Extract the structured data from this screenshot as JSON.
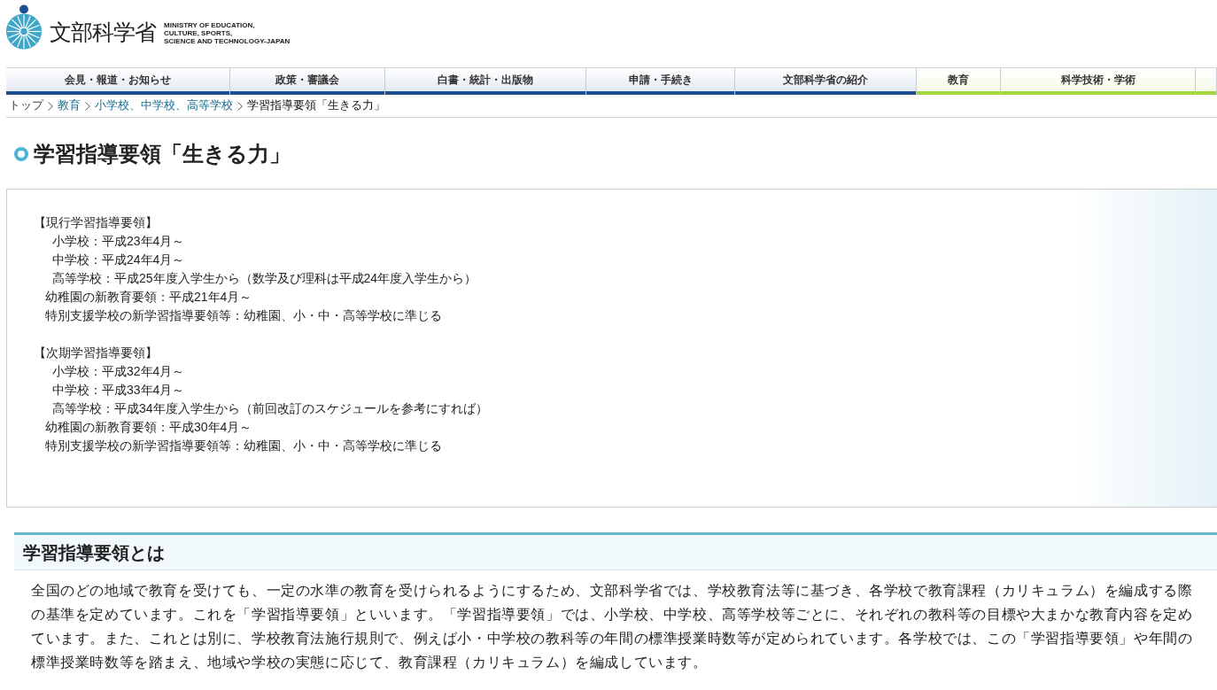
{
  "logo": {
    "name": "文部科学省",
    "tagline": [
      "MINISTRY OF EDUCATION,",
      "CULTURE, SPORTS,",
      "SCIENCE AND TECHNOLOGY-JAPAN"
    ]
  },
  "nav": [
    {
      "label": "会見・報道・お知らせ",
      "color": "#1c4f8f"
    },
    {
      "label": "政策・審議会",
      "color": "#1c4f8f"
    },
    {
      "label": "白書・統計・出版物",
      "color": "#1c4f8f"
    },
    {
      "label": "申請・手続き",
      "color": "#1c4f8f"
    },
    {
      "label": "文部科学省の紹介",
      "color": "#1c4f8f"
    },
    {
      "label": "教育",
      "color": "#a5d63f"
    },
    {
      "label": "科学技術・学術",
      "color": "#a5d63f"
    },
    {
      "color": "#a5d63f"
    }
  ],
  "breadcrumb": [
    {
      "label": "トップ",
      "kind": "top"
    },
    {
      "label": "教育",
      "kind": "link"
    },
    {
      "label": "小学校、中学校、高等学校",
      "kind": "link"
    },
    {
      "label": "学習指導要領「生きる力」",
      "kind": "current"
    }
  ],
  "title": "学習指導要領「生きる力」",
  "schedule": [
    {
      "heading": "【現行学習指導要領】",
      "items": [
        {
          "kind": "school",
          "text": "小学校：平成23年4月～"
        },
        {
          "kind": "school",
          "text": "中学校：平成24年4月～"
        },
        {
          "kind": "school",
          "text": "高等学校：平成25年度入学生から（数学及び理科は平成24年度入学生から）"
        },
        {
          "kind": "other",
          "text": "幼稚園の新教育要領：平成21年4月～"
        },
        {
          "kind": "other",
          "text": "特別支援学校の新学習指導要領等：幼稚園、小・中・高等学校に準じる"
        }
      ]
    },
    {
      "heading": "【次期学習指導要領】",
      "items": [
        {
          "kind": "school",
          "text": "小学校：平成32年4月～"
        },
        {
          "kind": "school",
          "text": "中学校：平成33年4月～"
        },
        {
          "kind": "school",
          "text": "高等学校：平成34年度入学生から（前回改訂のスケジュールを参考にすれば）"
        },
        {
          "kind": "other",
          "text": "幼稚園の新教育要領：平成30年4月～"
        },
        {
          "kind": "other",
          "text": "特別支援学校の新学習指導要領等：幼稚園、小・中・高等学校に準じる"
        }
      ]
    }
  ],
  "section": {
    "heading": "学習指導要領とは",
    "paragraph": "全国のどの地域で教育を受けても、一定の水準の教育を受けられるようにするため、文部科学省では、学校教育法等に基づき、各学校で教育課程（カリキュラム）を編成する際の基準を定めています。これを「学習指導要領」といいます。「学習指導要領」では、小学校、中学校、高等学校等ごとに、それぞれの教科等の目標や大まかな教育内容を定めています。また、これとは別に、学校教育法施行規則で、例えば小・中学校の教科等の年間の標準授業時数等が定められています。各学校では、この「学習指導要領」や年間の標準授業時数等を踏まえ、地域や学校の実態に応じて、教育課程（カリキュラム）を編成しています。"
  }
}
